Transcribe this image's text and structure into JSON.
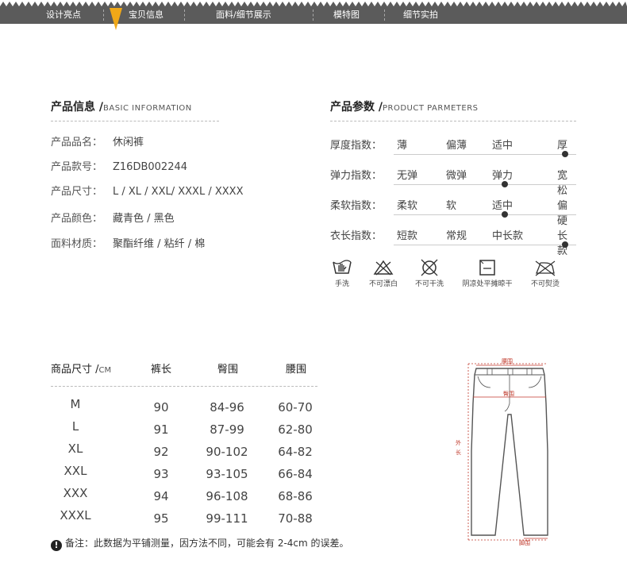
{
  "nav": {
    "tabs": [
      "设计亮点",
      "宝贝信息",
      "面料/细节展示",
      "模特图",
      "细节实拍"
    ],
    "accent": "#f0a818",
    "bg": "#5b5b5b"
  },
  "basic": {
    "title": "产品信息 /",
    "title_en": "BASIC INFORMATION",
    "rows": [
      {
        "label": "产品品名：",
        "value": "休闲裤"
      },
      {
        "label": "产品款号：",
        "value": "Z16DB002244"
      },
      {
        "label": "产品尺寸：",
        "value": "L / XL / XXL/ XXXL / XXXX"
      },
      {
        "label": "产品颜色：",
        "value": "藏青色 / 黑色"
      },
      {
        "label": "面料材质：",
        "value": "聚酯纤维 / 粘纤 / 棉"
      }
    ]
  },
  "params": {
    "title": "产品参数 /",
    "title_en": "PRODUCT PARMETERS",
    "rows": [
      {
        "label": "厚度指数：",
        "options": [
          "薄",
          "偏薄",
          "适中",
          "厚"
        ],
        "selected": 3
      },
      {
        "label": "弹力指数：",
        "options": [
          "无弹",
          "微弹",
          "弹力",
          "宽松"
        ],
        "selected": 2
      },
      {
        "label": "柔软指数：",
        "options": [
          "柔软",
          "软",
          "适中",
          "偏硬"
        ],
        "selected": 2
      },
      {
        "label": "衣长指数：",
        "options": [
          "短款",
          "常规",
          "中长款",
          "长款"
        ],
        "selected": 3
      }
    ]
  },
  "care": [
    {
      "icon": "hand-wash-icon",
      "label": "手洗"
    },
    {
      "icon": "no-bleach-icon",
      "label": "不可漂白"
    },
    {
      "icon": "no-dry-clean-icon",
      "label": "不可干洗"
    },
    {
      "icon": "flat-dry-shade-icon",
      "label": "阴凉处平摊晾干"
    },
    {
      "icon": "no-iron-icon",
      "label": "不可熨烫"
    }
  ],
  "size_table": {
    "header_title": "商品尺寸 /",
    "header_unit": "CM",
    "columns": [
      "裤长",
      "臀围",
      "腰围"
    ],
    "rows": [
      {
        "size": "M",
        "length": "90",
        "hip": "84-96",
        "waist": "60-70"
      },
      {
        "size": "L",
        "length": "91",
        "hip": "87-99",
        "waist": "62-80"
      },
      {
        "size": "XL",
        "length": "92",
        "hip": "90-102",
        "waist": "64-82"
      },
      {
        "size": "XXL",
        "length": "93",
        "hip": "93-105",
        "waist": "66-84"
      },
      {
        "size": "XXX",
        "length": "94",
        "hip": "96-108",
        "waist": "68-86"
      },
      {
        "size": "XXXL",
        "length": "95",
        "hip": "99-111",
        "waist": "70-88"
      }
    ]
  },
  "pants_diagram": {
    "waist_label": "腰围",
    "hip_label": "臀围",
    "length_label_1": "外",
    "length_label_2": "长",
    "hem_label": "脚围",
    "accent": "#c0392b"
  },
  "note": "备注：此数据为平铺测量，因方法不同，可能会有 2-4cm 的误差。"
}
